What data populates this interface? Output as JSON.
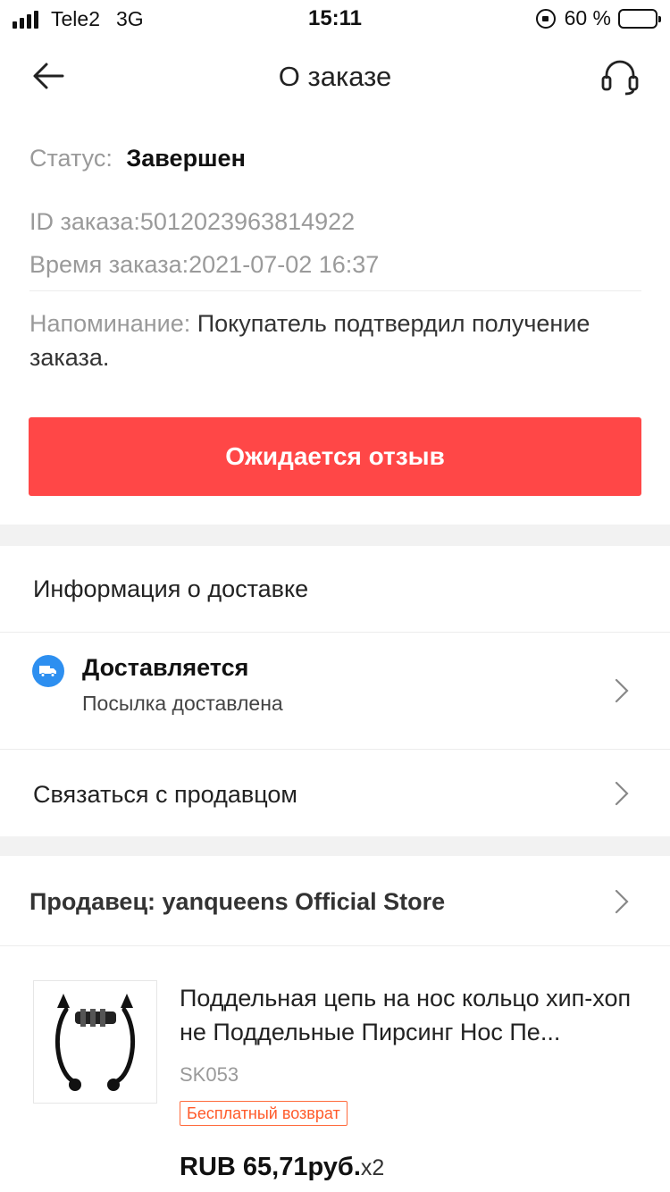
{
  "status_bar": {
    "carrier": "Tele2",
    "network": "3G",
    "time": "15:11",
    "battery_percent": "60 %",
    "battery_level": 0.6
  },
  "header": {
    "title": "О заказе",
    "back_icon": "arrow-left-icon",
    "support_icon": "headset-icon"
  },
  "order": {
    "status_label": "Статус:",
    "status_value": "Завершен",
    "id_text": "ID заказа:5012023963814922",
    "time_text": "Время заказа:2021-07-02 16:37",
    "reminder_label": "Напоминание:",
    "reminder_text": "Покупатель подтвердил получение заказа."
  },
  "review_button": "Ожидается отзыв",
  "delivery": {
    "section_title": "Информация о доставке",
    "status_title": "Доставляется",
    "status_sub": "Посылка доставлена",
    "contact_seller": "Связаться с продавцом"
  },
  "seller": {
    "label": "Продавец: yanqueens Official Store"
  },
  "product": {
    "title": "Поддельная цепь на нос кольцо хип-хоп не Поддельные Пирсинг Нос Пе...",
    "sku": "SK053",
    "badge": "Бесплатный возврат",
    "price": "RUB 65,71руб.",
    "quantity": "x2"
  },
  "colors": {
    "accent_red": "#ff4747",
    "truck_blue": "#2d8ff0",
    "badge_orange": "#ff5a2a"
  }
}
